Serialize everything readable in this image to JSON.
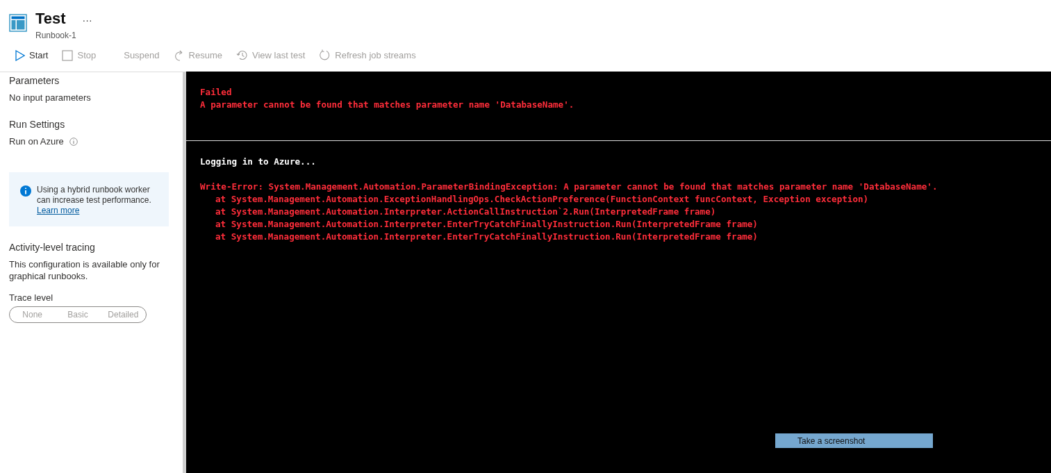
{
  "header": {
    "title": "Test",
    "subtitle": "Runbook-1",
    "more": "···"
  },
  "toolbar": [
    {
      "kind": "play",
      "label": "Start",
      "disabled": false
    },
    {
      "kind": "stop",
      "label": "Stop",
      "disabled": true
    },
    {
      "kind": "none",
      "label": "Suspend",
      "disabled": true
    },
    {
      "kind": "resume",
      "label": "Resume",
      "disabled": true
    },
    {
      "kind": "history",
      "label": "View last test",
      "disabled": true
    },
    {
      "kind": "refresh",
      "label": "Refresh job streams",
      "disabled": true
    }
  ],
  "sidebar": {
    "parameters_heading": "Parameters",
    "parameters_text": "No input parameters",
    "run_heading": "Run Settings",
    "run_text": "Run on Azure",
    "info": {
      "text": "Using a hybrid runbook worker can increase test performance.",
      "link": "Learn more"
    },
    "tracing_heading": "Activity-level tracing",
    "tracing_text": "This configuration is available only for graphical runbooks.",
    "trace_label": "Trace level",
    "trace_options": [
      {
        "label": "None",
        "selected": false
      },
      {
        "label": "Basic",
        "selected": false
      },
      {
        "label": "Detailed",
        "selected": false
      }
    ],
    "trace_disabled": true
  },
  "status_output": [
    {
      "kind": "error",
      "text": "Failed"
    },
    {
      "kind": "error",
      "text": "A parameter cannot be found that matches parameter name 'DatabaseName'."
    }
  ],
  "stream_output": [
    {
      "kind": "info",
      "text": "Logging in to Azure..."
    },
    {
      "kind": "gap"
    },
    {
      "kind": "error",
      "text": "Write-Error: System.Management.Automation.ParameterBindingException: A parameter cannot be found that matches parameter name 'DatabaseName'."
    },
    {
      "kind": "stack",
      "text": "at System.Management.Automation.ExceptionHandlingOps.CheckActionPreference(FunctionContext funcContext, Exception exception)"
    },
    {
      "kind": "stack",
      "text": "at System.Management.Automation.Interpreter.ActionCallInstruction`2.Run(InterpretedFrame frame)"
    },
    {
      "kind": "stack",
      "text": "at System.Management.Automation.Interpreter.EnterTryCatchFinallyInstruction.Run(InterpretedFrame frame)"
    },
    {
      "kind": "stack",
      "text": "at System.Management.Automation.Interpreter.EnterTryCatchFinallyInstruction.Run(InterpretedFrame frame)"
    }
  ],
  "screenshot_button": "Take a screenshot"
}
